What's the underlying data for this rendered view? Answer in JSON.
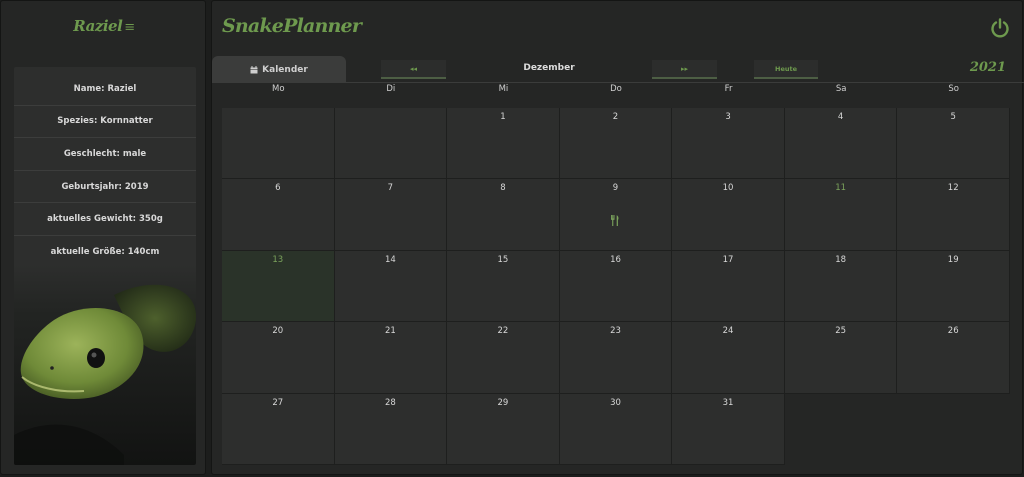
{
  "sidebar": {
    "brand": "Raziel",
    "menu_icon": "≡",
    "profile": {
      "name": "Name: Raziel",
      "species": "Spezies: Kornnatter",
      "sex": "Geschlecht: male",
      "birth_year": "Geburtsjahr: 2019",
      "weight": "aktuelles Gewicht: 350g",
      "length": "aktuelle Größe: 140cm"
    }
  },
  "header": {
    "title": "SnakePlanner",
    "power_icon": "power-icon"
  },
  "tabs": {
    "calendar_label": "Kalender"
  },
  "nav": {
    "prev_label": "◂◂",
    "next_label": "▸▸",
    "today_label": "Heute",
    "month": "Dezember",
    "year": "2021"
  },
  "weekdays": [
    "Mo",
    "Di",
    "Mi",
    "Do",
    "Fr",
    "Sa",
    "So"
  ],
  "days": {
    "d1": "1",
    "d2": "2",
    "d3": "3",
    "d4": "4",
    "d5": "5",
    "d6": "6",
    "d7": "7",
    "d8": "8",
    "d9": "9",
    "d10": "10",
    "d11": "11",
    "d12": "12",
    "d13": "13",
    "d14": "14",
    "d15": "15",
    "d16": "16",
    "d17": "17",
    "d18": "18",
    "d19": "19",
    "d20": "20",
    "d21": "21",
    "d22": "22",
    "d23": "23",
    "d24": "24",
    "d25": "25",
    "d26": "26",
    "d27": "27",
    "d28": "28",
    "d29": "29",
    "d30": "30",
    "d31": "31"
  },
  "colors": {
    "accent": "#6e9a4e",
    "today_bg": "#2a3329"
  }
}
